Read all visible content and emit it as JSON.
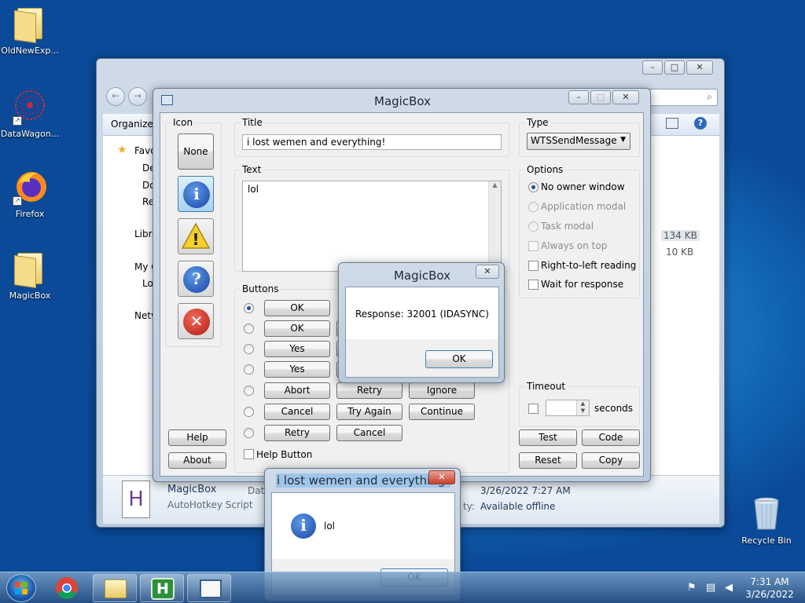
{
  "desktop": {
    "icons": [
      {
        "label": "OldNewExp..."
      },
      {
        "label": "DataWagon..."
      },
      {
        "label": "Firefox"
      },
      {
        "label": "MagicBox"
      },
      {
        "label": "Recycle Bin"
      }
    ]
  },
  "explorer": {
    "toolbar_organize": "Organize",
    "nav": [
      "Favo",
      "De",
      "Do",
      "Re",
      "Libra",
      "My C",
      "Lo",
      "Netw"
    ],
    "sizes": [
      "134 KB",
      "10 KB"
    ],
    "details": {
      "name": "MagicBox",
      "type": "AutoHotkey Script",
      "date_label": "Date",
      "date_value": "3/26/2022 7:27 AM",
      "avail_label": "ty:",
      "avail_value": "Available offline",
      "file_icon_letter": "H"
    }
  },
  "magicbox": {
    "title": "MagicBox",
    "icon_label": "Icon",
    "icon_none": "None",
    "title_label": "Title",
    "title_value": "i lost wemen and everything!",
    "type_label": "Type",
    "type_value": "WTSSendMessage",
    "text_label": "Text",
    "text_value": "lol",
    "options_label": "Options",
    "options": [
      {
        "label": "No owner window",
        "kind": "radio",
        "checked": true,
        "enabled": true
      },
      {
        "label": "Application modal",
        "kind": "radio",
        "checked": false,
        "enabled": false
      },
      {
        "label": "Task modal",
        "kind": "radio",
        "checked": false,
        "enabled": false
      },
      {
        "label": "Always on top",
        "kind": "check",
        "checked": false,
        "enabled": false
      },
      {
        "label": "Right-to-left reading",
        "kind": "check",
        "checked": false,
        "enabled": true
      },
      {
        "label": "Wait for response",
        "kind": "check",
        "checked": false,
        "enabled": true
      }
    ],
    "buttons_label": "Buttons",
    "button_rows": [
      [
        "OK"
      ],
      [
        "OK",
        ""
      ],
      [
        "Yes",
        ""
      ],
      [
        "Yes",
        ""
      ],
      [
        "Abort",
        "Retry",
        "Ignore"
      ],
      [
        "Cancel",
        "Try Again",
        "Continue"
      ],
      [
        "Retry",
        "Cancel"
      ]
    ],
    "help_button_check": "Help Button",
    "timeout_label": "Timeout",
    "timeout_unit": "seconds",
    "help": "Help",
    "about": "About",
    "test": "Test",
    "code": "Code",
    "reset": "Reset",
    "copy": "Copy"
  },
  "response_dialog": {
    "title": "MagicBox",
    "message": "Response: 32001 (IDASYNC)",
    "ok": "OK"
  },
  "message_dialog": {
    "title": "i lost wemen and everything!",
    "message": "lol",
    "ok": "OK"
  },
  "taskbar": {
    "time": "7:31 AM",
    "date": "3/26/2022",
    "h_letter": "H"
  }
}
